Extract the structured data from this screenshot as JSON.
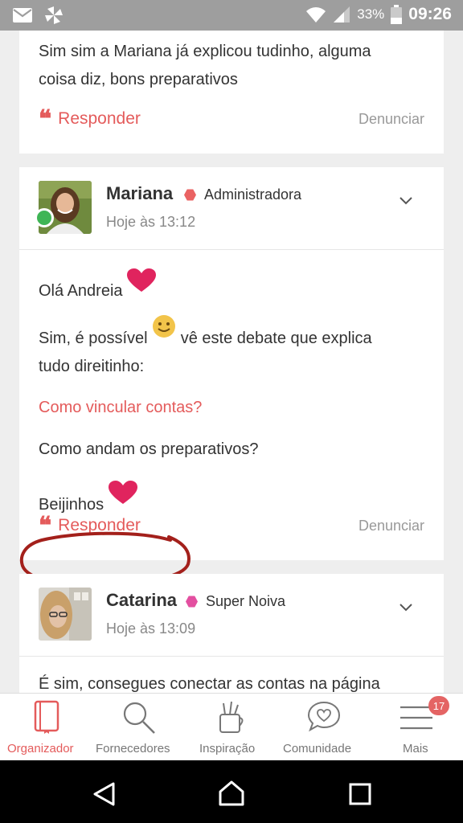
{
  "status_bar": {
    "battery": "33%",
    "time": "09:26",
    "icons": [
      "mail-icon",
      "pinwheel-icon",
      "wifi-icon",
      "signal-icon",
      "battery-icon"
    ]
  },
  "posts": [
    {
      "lines": [
        "Sim sim a Mariana já explicou tudinho, alguma",
        "coisa diz, bons preparativos"
      ],
      "reply_label": "Responder",
      "report_label": "Denunciar"
    },
    {
      "author": "Mariana",
      "role": "Administradora",
      "role_color": "#ea6363",
      "time": "Hoje às 13:12",
      "greeting": "Olá Andreia",
      "line1": "Sim, é possível",
      "line1_after": "vê este debate que explica",
      "line2": "tudo direitinho:",
      "link": "Como vincular contas?",
      "question": "Como andam os preparativos?",
      "signoff": "Beijinhos",
      "reply_label": "Responder",
      "report_label": "Denunciar"
    },
    {
      "author": "Catarina",
      "role": "Super Noiva",
      "role_color": "#e34fa0",
      "time": "Hoje às 13:09",
      "text": "É sim, consegues conectar as contas na página"
    }
  ],
  "bottom_nav": [
    {
      "label": "Organizador",
      "icon": "notebook-icon",
      "active": true
    },
    {
      "label": "Fornecedores",
      "icon": "search-icon",
      "active": false
    },
    {
      "label": "Inspiração",
      "icon": "pencil-cup-icon",
      "active": false
    },
    {
      "label": "Comunidade",
      "icon": "chat-heart-icon",
      "active": false
    },
    {
      "label": "Mais",
      "icon": "menu-icon",
      "active": false,
      "badge": "17"
    }
  ],
  "colors": {
    "accent": "#e45b5b",
    "online": "#3fb556",
    "heart": "#e0245e"
  }
}
